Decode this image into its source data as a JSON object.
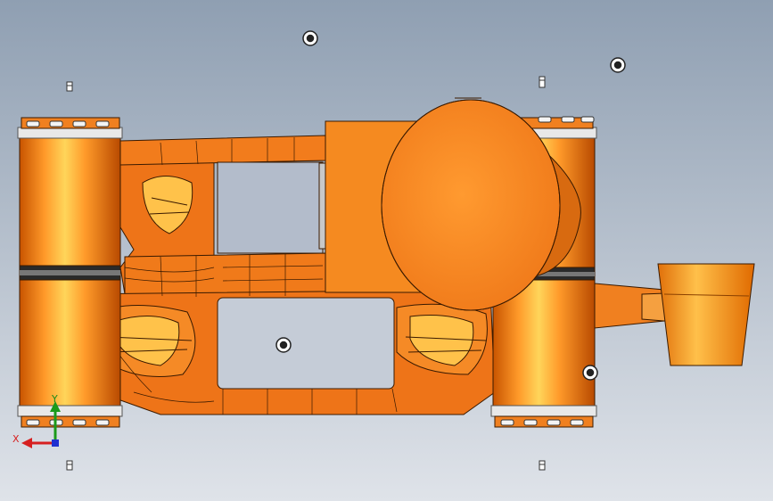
{
  "viewport": {
    "background_top": "#8f9fb2",
    "background_bottom": "#dfe3e9",
    "part_color": "#f07a1a",
    "part_highlight": "#ffc24a",
    "part_shadow": "#c85a00",
    "edge_color": "#3a1a00"
  },
  "triad": {
    "x_label": "X",
    "y_label": "Y",
    "x_color": "#d62020",
    "y_color": "#1a9a1a",
    "z_color": "#2030d0"
  },
  "icons": {
    "origin_marker": "origin-circle-icon",
    "pin": "datum-pin-icon"
  }
}
